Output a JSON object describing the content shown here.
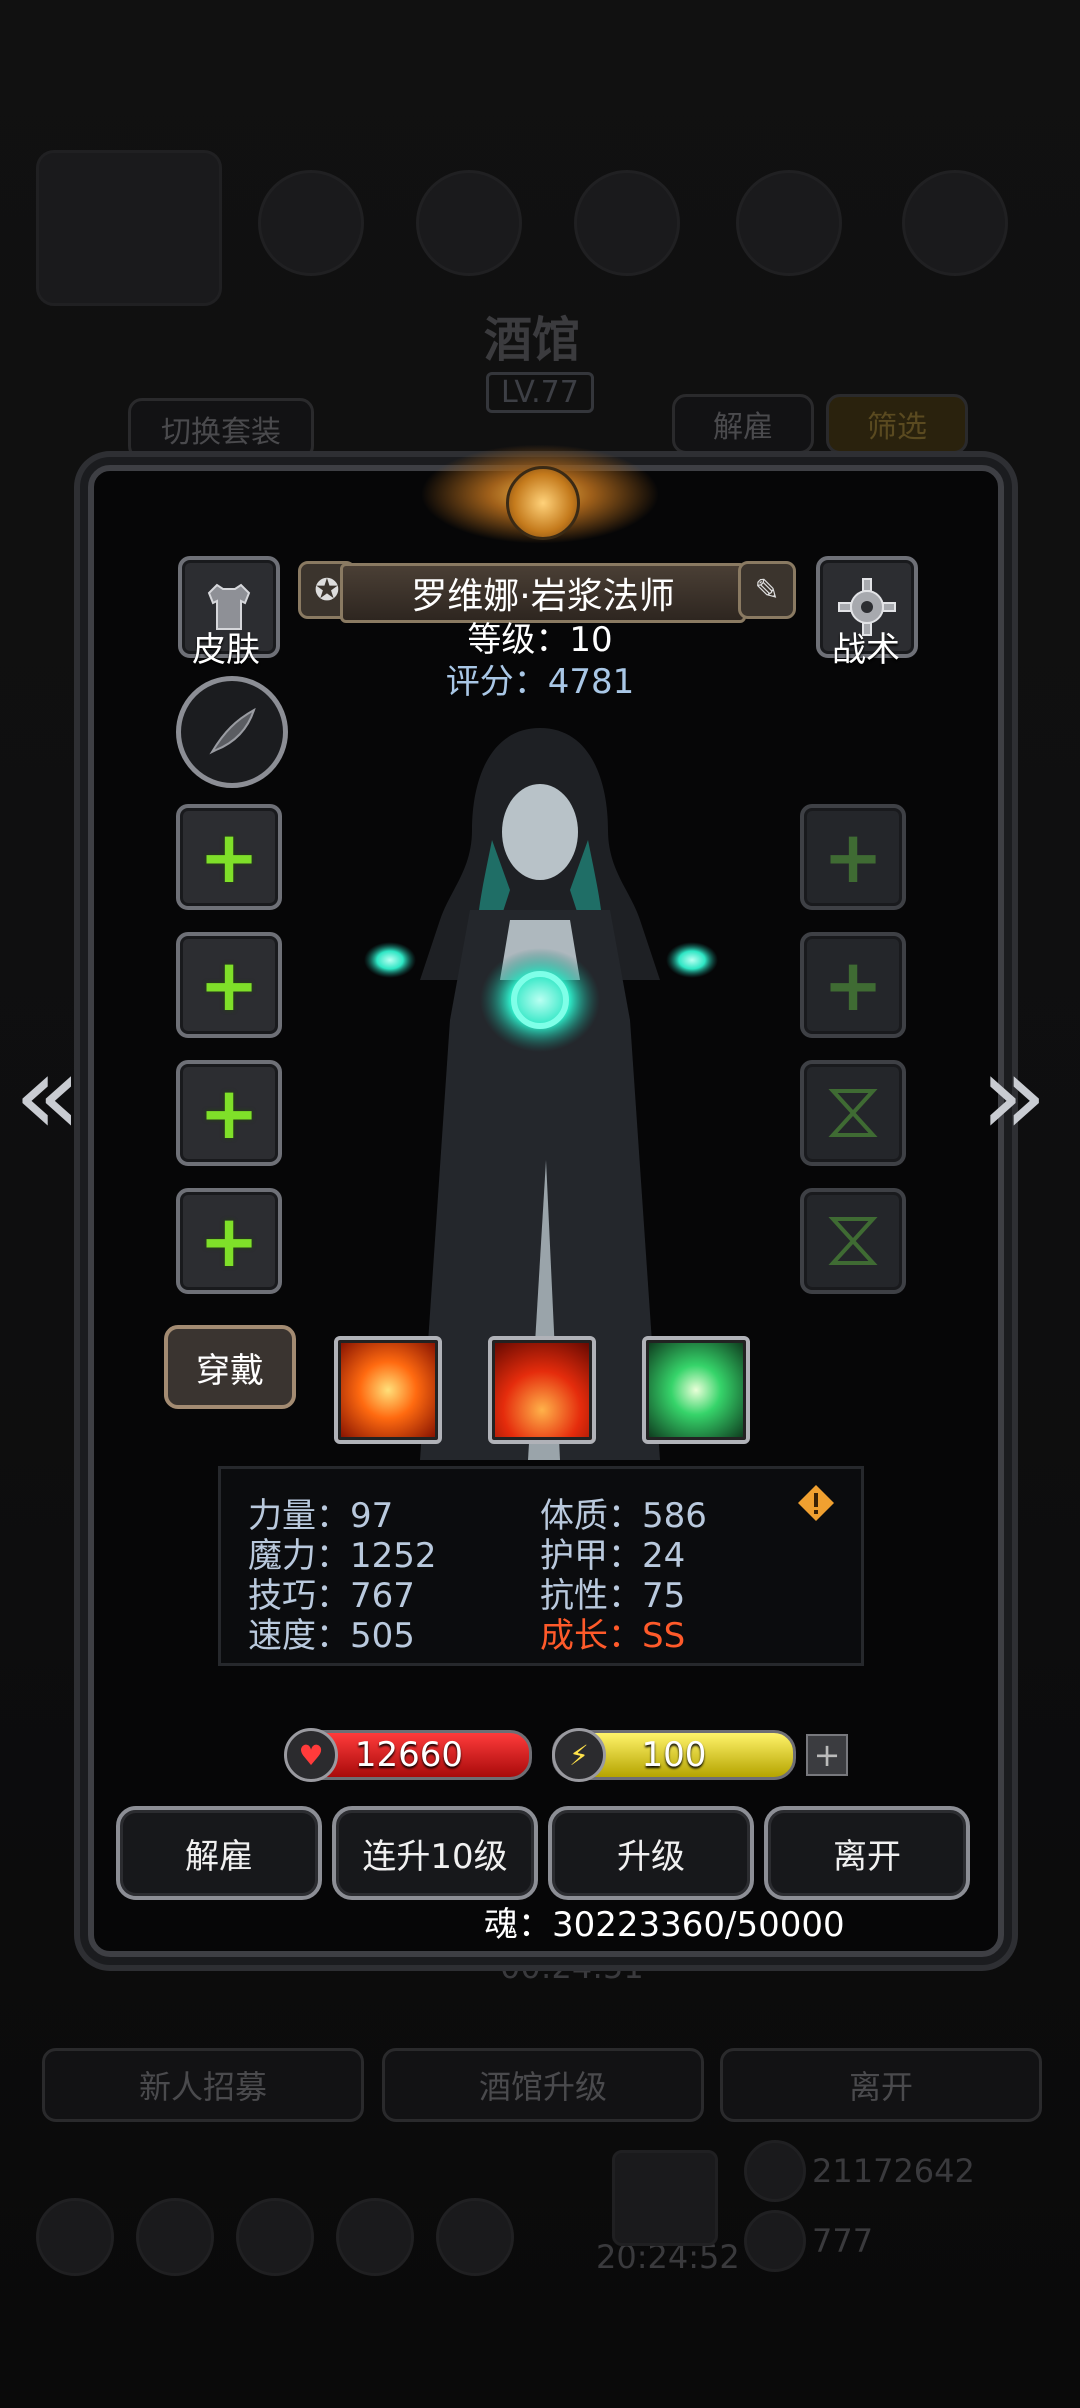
{
  "background": {
    "title": "酒馆",
    "level": "LV.77",
    "switch_outfit": "切换套装",
    "dismiss": "解雇",
    "filter": "筛选",
    "timer": "00:24:51",
    "recruit": "新人招募",
    "upgrade_tavern": "酒馆升级",
    "leave": "离开",
    "gold": "21172642",
    "gems": "777",
    "clock": "20:24:52"
  },
  "hero": {
    "name": "罗维娜·岩浆法师",
    "level_label": "等级：10",
    "score_label": "评分：4781"
  },
  "left_panel": {
    "skin_label": "皮肤",
    "wear_label": "穿戴"
  },
  "right_panel": {
    "tactics_label": "战术"
  },
  "stats": {
    "strength": "力量：97",
    "magic": "魔力：1252",
    "skill": "技巧：767",
    "speed": "速度：505",
    "constitution": "体质：586",
    "armor": "护甲：24",
    "resistance": "抗性：75",
    "growth": "成长：SS"
  },
  "bars": {
    "hp": "12660",
    "energy": "100"
  },
  "actions": {
    "dismiss": "解雇",
    "level_up_10": "连升10级",
    "level_up": "升级",
    "leave": "离开"
  },
  "soul": "魂：30223360/50000",
  "colors": {
    "growth_red": "#ff5a2a",
    "stat_blue": "#b9c9dd",
    "plus_green": "#7fe029",
    "hp_red": "#d31a1a",
    "energy_yellow": "#e8d81c"
  }
}
